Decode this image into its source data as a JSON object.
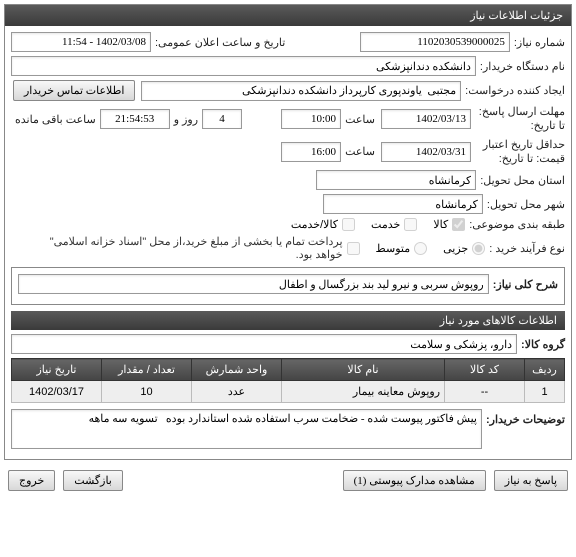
{
  "header": {
    "title": "جزئیات اطلاعات نیاز"
  },
  "info": {
    "need_number_label": "شماره نیاز:",
    "need_number": "1102030539000025",
    "public_datetime_label": "تاریخ و ساعت اعلان عمومی:",
    "public_datetime": "1402/03/08 - 11:54",
    "buyer_label": "نام دستگاه خریدار:",
    "buyer": "دانشکده دندانپزشکی",
    "creator_label": "ایجاد کننده درخواست:",
    "creator": "مجتبی  یاوندپوری کارپرداز دانشکده دندانپزشکی",
    "contact_btn": "اطلاعات تماس خریدار",
    "deadline_label": "مهلت ارسال پاسخ: تا تاریخ:",
    "deadline_date": "1402/03/13",
    "time_label": "ساعت",
    "deadline_time": "10:00",
    "days_label": "روز و",
    "days": "4",
    "remaining_time": "21:54:53",
    "remaining_label": "ساعت باقی مانده",
    "validity_label": "حداقل تاریخ اعتبار قیمت: تا تاریخ:",
    "validity_date": "1402/03/31",
    "validity_time": "16:00",
    "province_label": "استان محل تحویل:",
    "province": "کرمانشاه",
    "city_label": "شهر محل تحویل:",
    "city": "کرمانشاه",
    "category_label": "طبقه بندی موضوعی:",
    "cat_goods": "کالا",
    "cat_service": "خدمت",
    "cat_both": "کالا/خدمت",
    "process_label": "نوع فرآیند خرید :",
    "p_small": "جزیی",
    "p_medium": "متوسط",
    "p_note": "پرداخت تمام یا بخشی از مبلغ خرید،از محل \"اسناد خزانه اسلامی\" خواهد بود.",
    "desc_label": "شرح کلی نیاز:",
    "desc": "روپوش سربی و نیرو لید بند بزرگسال و اطفال"
  },
  "goods": {
    "section_title": "اطلاعات کالاهای مورد نیاز",
    "group_label": "گروه کالا:",
    "group": "دارو، پزشکی و سلامت",
    "cols": {
      "row": "ردیف",
      "code": "کد کالا",
      "name": "نام کالا",
      "unit": "واحد شمارش",
      "qty": "تعداد / مقدار",
      "date": "تاریخ نیاز"
    },
    "rows": [
      {
        "row": "1",
        "code": "--",
        "name": "روپوش معاینه بیمار",
        "unit": "عدد",
        "qty": "10",
        "date": "1402/03/17"
      }
    ],
    "buyer_notes_label": "توضیحات خریدار:",
    "buyer_notes": "پیش فاکتور پیوست شده - ضخامت سرب استفاده شده استاندارد بوده   تسویه سه ماهه"
  },
  "buttons": {
    "respond": "پاسخ به نیاز",
    "attachments": "مشاهده مدارک پیوستی (1)",
    "back": "بازگشت",
    "exit": "خروج"
  }
}
